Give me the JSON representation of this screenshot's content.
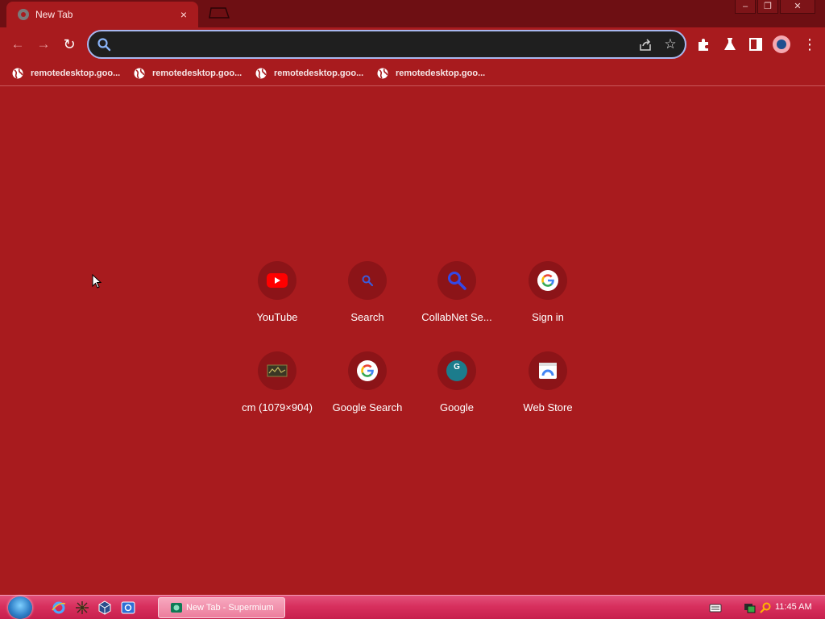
{
  "window": {
    "tab_title": "New Tab",
    "tab_close": "×",
    "minimize": "‒",
    "restore": "❐",
    "close": "✕"
  },
  "toolbar": {
    "back": "←",
    "forward": "→",
    "reload": "↻",
    "omnibox_value": "",
    "star": "☆",
    "menu": "⋮"
  },
  "bookmarks": [
    {
      "label": "remotedesktop.goo..."
    },
    {
      "label": "remotedesktop.goo..."
    },
    {
      "label": "remotedesktop.goo..."
    },
    {
      "label": "remotedesktop.goo..."
    }
  ],
  "shortcuts": [
    {
      "label": "YouTube",
      "icon": "youtube-icon"
    },
    {
      "label": "Search",
      "icon": "search-icon"
    },
    {
      "label": "CollabNet Se...",
      "icon": "search-icon"
    },
    {
      "label": "Sign in",
      "icon": "google-icon"
    },
    {
      "label": "cm (1079×904)",
      "icon": "thumbnail-icon"
    },
    {
      "label": "Google Search",
      "icon": "google-icon"
    },
    {
      "label": "Google",
      "icon": "google-g-icon"
    },
    {
      "label": "Web Store",
      "icon": "web-store-icon"
    }
  ],
  "shortcut_google_letter": "G",
  "taskbar": {
    "task_label": "New Tab - Supermium",
    "clock": "11:45 AM"
  },
  "colors": {
    "page_background": "#a81b1e",
    "titlebar": "#6e0f13",
    "omnibox_border": "#a8b8f0",
    "taskbar": "#d8305e"
  }
}
